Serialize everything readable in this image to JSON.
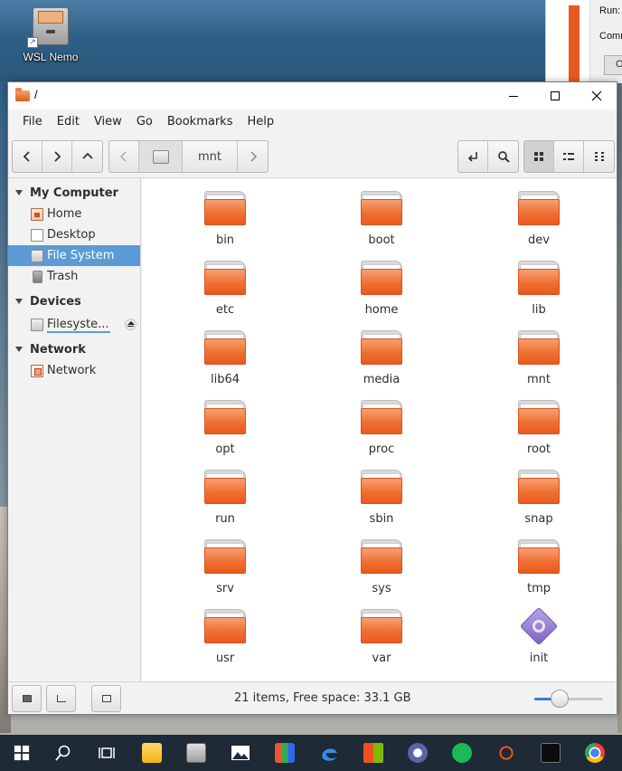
{
  "desktop": {
    "icon_label": "WSL Nemo",
    "bg_dialog": {
      "run_label": "Run:",
      "command_label": "Comm",
      "ok_label": "O"
    }
  },
  "window": {
    "title": "/",
    "menu": [
      "File",
      "Edit",
      "View",
      "Go",
      "Bookmarks",
      "Help"
    ],
    "breadcrumb": {
      "current": "mnt"
    }
  },
  "sidebar": {
    "sections": [
      {
        "title": "My Computer",
        "items": [
          "Home",
          "Desktop",
          "File System",
          "Trash"
        ],
        "selected": "File System"
      },
      {
        "title": "Devices",
        "items": [
          "Filesyste..."
        ]
      },
      {
        "title": "Network",
        "items": [
          "Network"
        ]
      }
    ]
  },
  "files": [
    {
      "name": "bin",
      "kind": "folder"
    },
    {
      "name": "boot",
      "kind": "folder"
    },
    {
      "name": "dev",
      "kind": "folder"
    },
    {
      "name": "etc",
      "kind": "folder"
    },
    {
      "name": "home",
      "kind": "folder"
    },
    {
      "name": "lib",
      "kind": "folder"
    },
    {
      "name": "lib64",
      "kind": "folder"
    },
    {
      "name": "media",
      "kind": "folder"
    },
    {
      "name": "mnt",
      "kind": "folder"
    },
    {
      "name": "opt",
      "kind": "folder"
    },
    {
      "name": "proc",
      "kind": "folder"
    },
    {
      "name": "root",
      "kind": "folder"
    },
    {
      "name": "run",
      "kind": "folder"
    },
    {
      "name": "sbin",
      "kind": "folder"
    },
    {
      "name": "snap",
      "kind": "folder"
    },
    {
      "name": "srv",
      "kind": "folder"
    },
    {
      "name": "sys",
      "kind": "folder"
    },
    {
      "name": "tmp",
      "kind": "folder"
    },
    {
      "name": "usr",
      "kind": "folder"
    },
    {
      "name": "var",
      "kind": "folder"
    },
    {
      "name": "init",
      "kind": "executable"
    }
  ],
  "statusbar": {
    "text": "21 items, Free space: 33.1 GB",
    "zoom_fraction": 0.5
  },
  "taskbar": {
    "icons": [
      "windows-start-icon",
      "search-icon",
      "task-view-icon",
      "file-explorer-icon",
      "nemo-icon",
      "photos-icon",
      "apps-grid-icon",
      "edge-icon",
      "store-icon",
      "vpn-lock-icon",
      "spotify-icon",
      "ubuntu-icon",
      "terminal-icon",
      "chrome-icon"
    ]
  },
  "colors": {
    "folder_orange": "#ef6f33",
    "selection": "#5b9bd5",
    "taskbar": "#1e2a36"
  }
}
